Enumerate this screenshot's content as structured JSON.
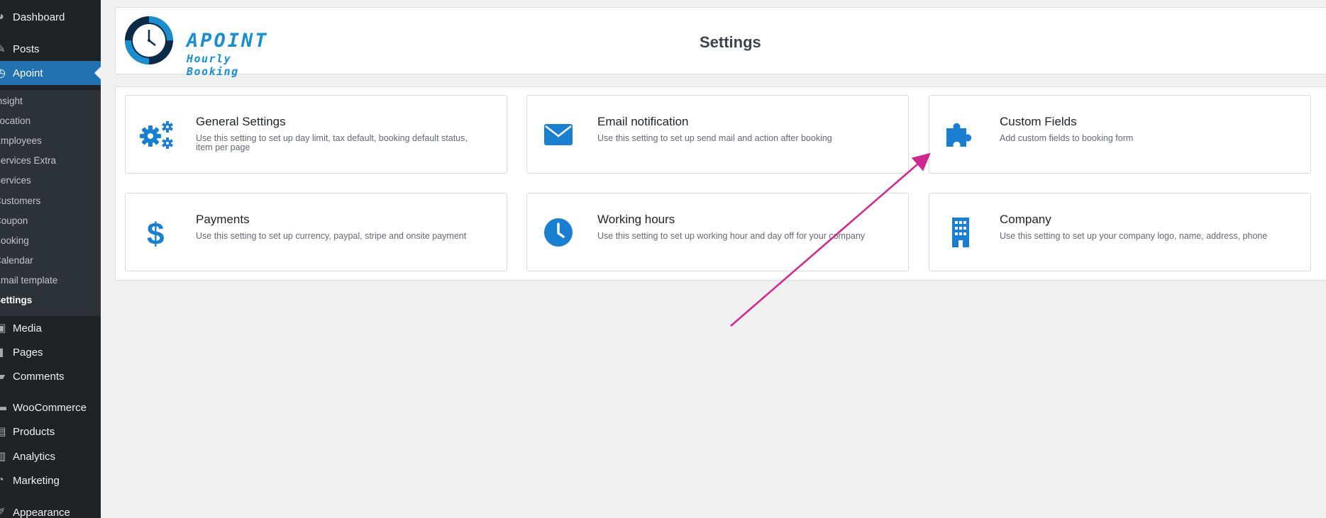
{
  "sidebar": {
    "items": [
      {
        "label": "Dashboard",
        "icon": "dashboard-icon"
      },
      {
        "label": "Posts",
        "icon": "pin-icon"
      },
      {
        "label": "Apoint",
        "icon": "clock-icon"
      },
      {
        "label": "Media",
        "icon": "media-icon"
      },
      {
        "label": "Pages",
        "icon": "page-icon"
      },
      {
        "label": "Comments",
        "icon": "comment-icon"
      },
      {
        "label": "WooCommerce",
        "icon": "woocommerce-icon"
      },
      {
        "label": "Products",
        "icon": "archive-icon"
      },
      {
        "label": "Analytics",
        "icon": "bar-chart-icon"
      },
      {
        "label": "Marketing",
        "icon": "megaphone-icon"
      },
      {
        "label": "Appearance",
        "icon": "brush-icon"
      }
    ],
    "submenu": [
      "Insight",
      "Location",
      "Employees",
      "Services Extra",
      "Services",
      "Customers",
      "Coupon",
      "Booking",
      "Calendar",
      "Email template",
      "Settings"
    ]
  },
  "header": {
    "brand_name": "APOINT",
    "brand_tagline": "Hourly Booking",
    "page_title": "Settings"
  },
  "cards": [
    {
      "title": "General Settings",
      "description": "Use this setting to set up day limit, tax default, booking default status, item per page",
      "icon": "gears-icon"
    },
    {
      "title": "Email notification",
      "description": "Use this setting to set up send mail and action after booking",
      "icon": "envelope-icon"
    },
    {
      "title": "Custom Fields",
      "description": "Add custom fields to booking form",
      "icon": "puzzle-icon"
    },
    {
      "title": "Payments",
      "description": "Use this setting to set up currency, paypal, stripe and onsite payment",
      "icon": "dollar-icon"
    },
    {
      "title": "Working hours",
      "description": "Use this setting to set up working hour and day off for your company",
      "icon": "clock-icon"
    },
    {
      "title": "Company",
      "description": "Use this setting to set up your company logo, name, address, phone",
      "icon": "building-icon"
    }
  ],
  "colors": {
    "accent": "#1a7fd0",
    "sidebar_bg": "#1d2327",
    "sidebar_active": "#2271b1",
    "annotation_arrow": "#d0268f"
  }
}
